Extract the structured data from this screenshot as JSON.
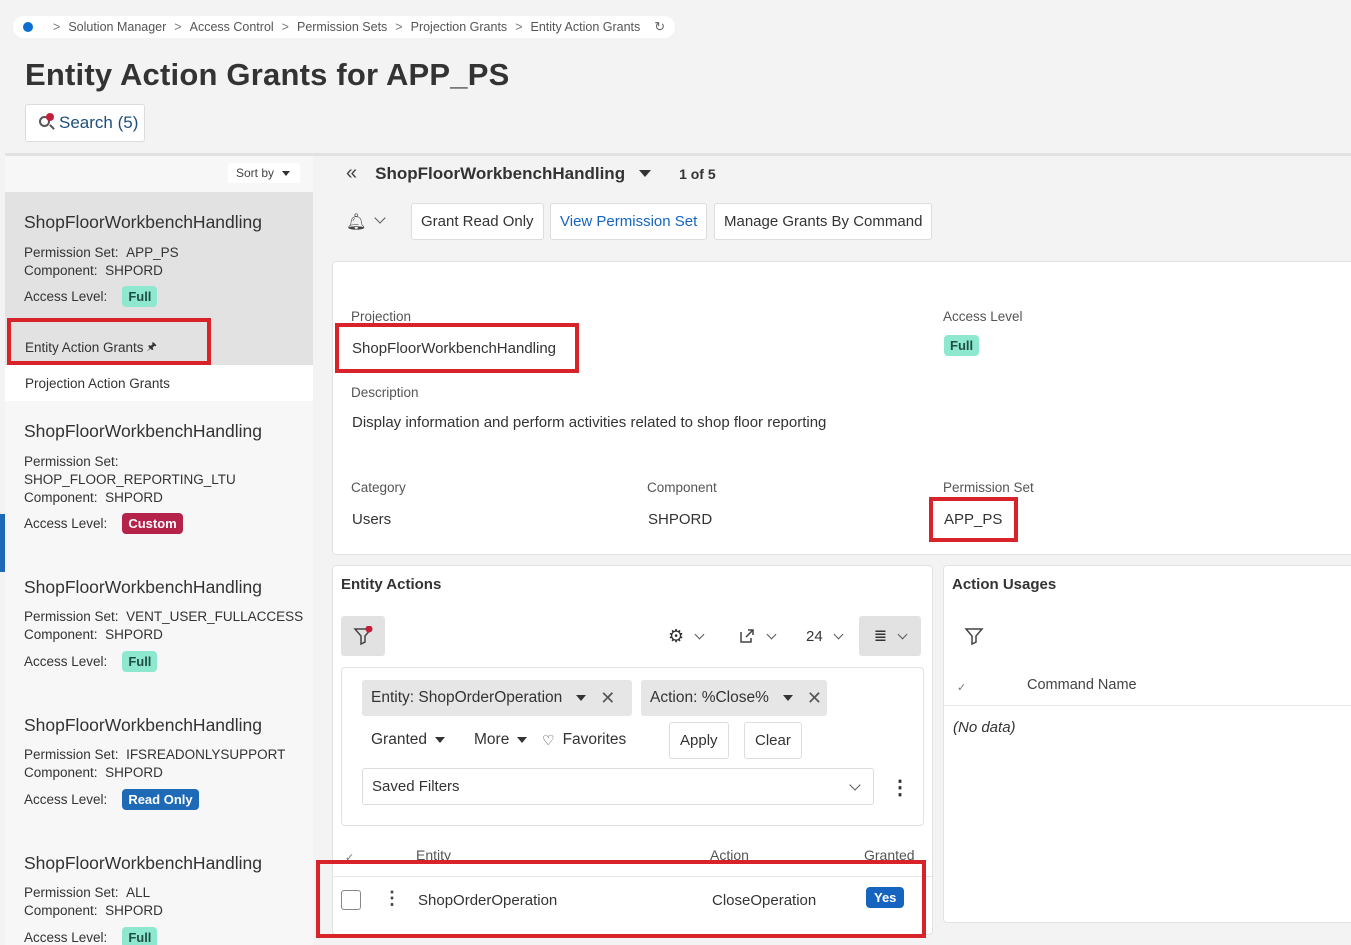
{
  "breadcrumb": {
    "items": [
      "Solution Manager",
      "Access Control",
      "Permission Sets",
      "Projection Grants",
      "Entity Action Grants"
    ],
    "refresh_icon": "refresh-icon"
  },
  "page": {
    "title": "Entity Action Grants for APP_PS",
    "search_label": "Search (5)"
  },
  "list": {
    "sort_label": "Sort by",
    "cards": [
      {
        "title": "ShopFloorWorkbenchHandling",
        "perm_label": "Permission Set:",
        "perm_value": "APP_PS",
        "comp_label": "Component:",
        "comp_value": "SHPORD",
        "level_label": "Access Level:",
        "level": "Full"
      },
      {
        "title": "ShopFloorWorkbenchHandling",
        "perm_label": "Permission Set:",
        "perm_value": "SHOP_FLOOR_REPORTING_LTU",
        "comp_label": "Component:",
        "comp_value": "SHPORD",
        "level_label": "Access Level:",
        "level": "Custom"
      },
      {
        "title": "ShopFloorWorkbenchHandling",
        "perm_label": "Permission Set:",
        "perm_value": "VENT_USER_FULLACCESS",
        "comp_label": "Component:",
        "comp_value": "SHPORD",
        "level_label": "Access Level:",
        "level": "Full"
      },
      {
        "title": "ShopFloorWorkbenchHandling",
        "perm_label": "Permission Set:",
        "perm_value": "IFSREADONLYSUPPORT",
        "comp_label": "Component:",
        "comp_value": "SHPORD",
        "level_label": "Access Level:",
        "level": "Read Only"
      },
      {
        "title": "ShopFloorWorkbenchHandling",
        "perm_label": "Permission Set:",
        "perm_value": "ALL",
        "comp_label": "Component:",
        "comp_value": "SHPORD",
        "level_label": "Access Level:",
        "level": "Full"
      }
    ],
    "subnav": {
      "entity_action_grants": "Entity Action Grants",
      "projection_action_grants": "Projection Action Grants"
    }
  },
  "record": {
    "name": "ShopFloorWorkbenchHandling",
    "counter": "1 of 5",
    "buttons": {
      "grant_read_only": "Grant Read Only",
      "view_permission_set": "View Permission Set",
      "manage_grants": "Manage Grants By Command"
    }
  },
  "details": {
    "projection_label": "Projection",
    "projection_value": "ShopFloorWorkbenchHandling",
    "access_level_label": "Access Level",
    "access_level_value": "Full",
    "description_label": "Description",
    "description_value": "Display information and perform activities related to shop floor reporting",
    "category_label": "Category",
    "category_value": "Users",
    "component_label": "Component",
    "component_value": "SHPORD",
    "permission_set_label": "Permission Set",
    "permission_set_value": "APP_PS"
  },
  "entity_actions": {
    "title": "Entity Actions",
    "page_size": "24",
    "chip_entity": "Entity: ShopOrderOperation",
    "chip_action": "Action: %Close%",
    "granted_label": "Granted",
    "more_label": "More",
    "favorites_label": "Favorites",
    "apply_label": "Apply",
    "clear_label": "Clear",
    "saved_filters_label": "Saved Filters",
    "columns": {
      "entity": "Entity",
      "action": "Action",
      "granted": "Granted"
    },
    "rows": [
      {
        "entity": "ShopOrderOperation",
        "action": "CloseOperation",
        "granted": "Yes"
      }
    ]
  },
  "action_usages": {
    "title": "Action Usages",
    "column": "Command Name",
    "empty": "(No data)"
  },
  "colors": {
    "accent": "#0b6ed1",
    "highlight_box": "#d8232a",
    "full": "#8de8cf",
    "custom": "#b5234b",
    "readonly": "#1e6ab7"
  }
}
